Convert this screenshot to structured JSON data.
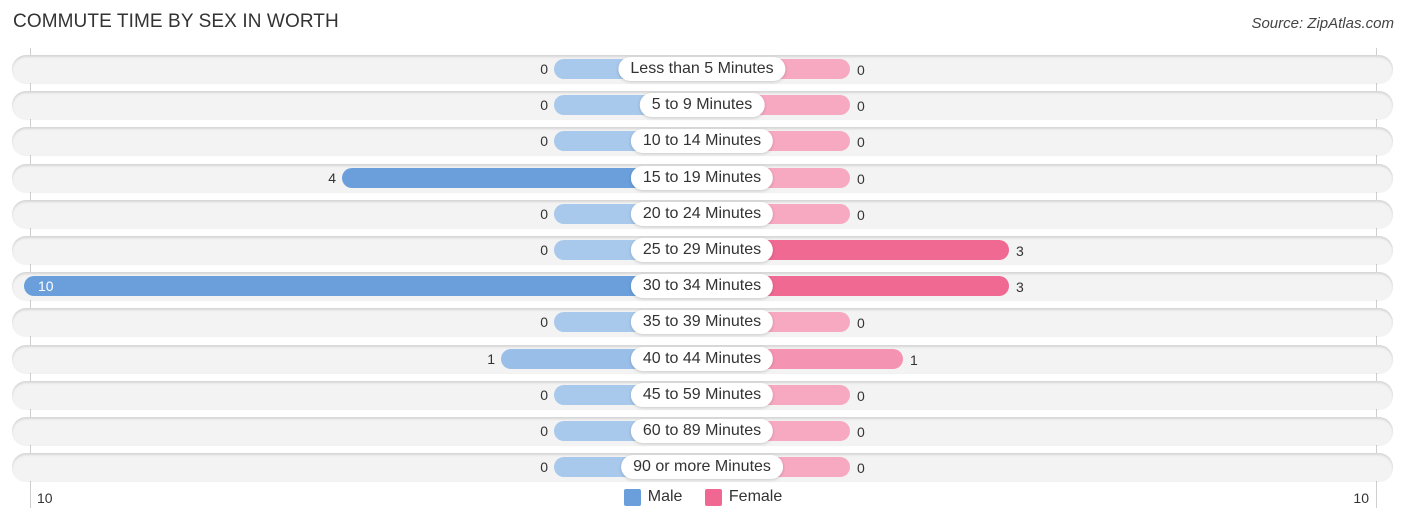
{
  "chart_data": {
    "type": "bar",
    "orientation": "horizontal-diverging",
    "title": "COMMUTE TIME BY SEX IN WORTH",
    "source": "Source: ZipAtlas.com",
    "categories": [
      "Less than 5 Minutes",
      "5 to 9 Minutes",
      "10 to 14 Minutes",
      "15 to 19 Minutes",
      "20 to 24 Minutes",
      "25 to 29 Minutes",
      "30 to 34 Minutes",
      "35 to 39 Minutes",
      "40 to 44 Minutes",
      "45 to 59 Minutes",
      "60 to 89 Minutes",
      "90 or more Minutes"
    ],
    "series": [
      {
        "name": "Male",
        "color": "#6a9fdc",
        "light_color": "#a8c8ec",
        "values": [
          0,
          0,
          0,
          4,
          0,
          0,
          10,
          0,
          1,
          0,
          0,
          0
        ]
      },
      {
        "name": "Female",
        "color": "#f06892",
        "light_color": "#f7a9c2",
        "values": [
          0,
          0,
          0,
          0,
          0,
          3,
          3,
          0,
          1,
          0,
          0,
          0
        ]
      }
    ],
    "axis": {
      "left_tick": "10",
      "right_tick": "10",
      "max": 10
    },
    "legend": {
      "position": "bottom-center",
      "items": [
        "Male",
        "Female"
      ]
    }
  }
}
